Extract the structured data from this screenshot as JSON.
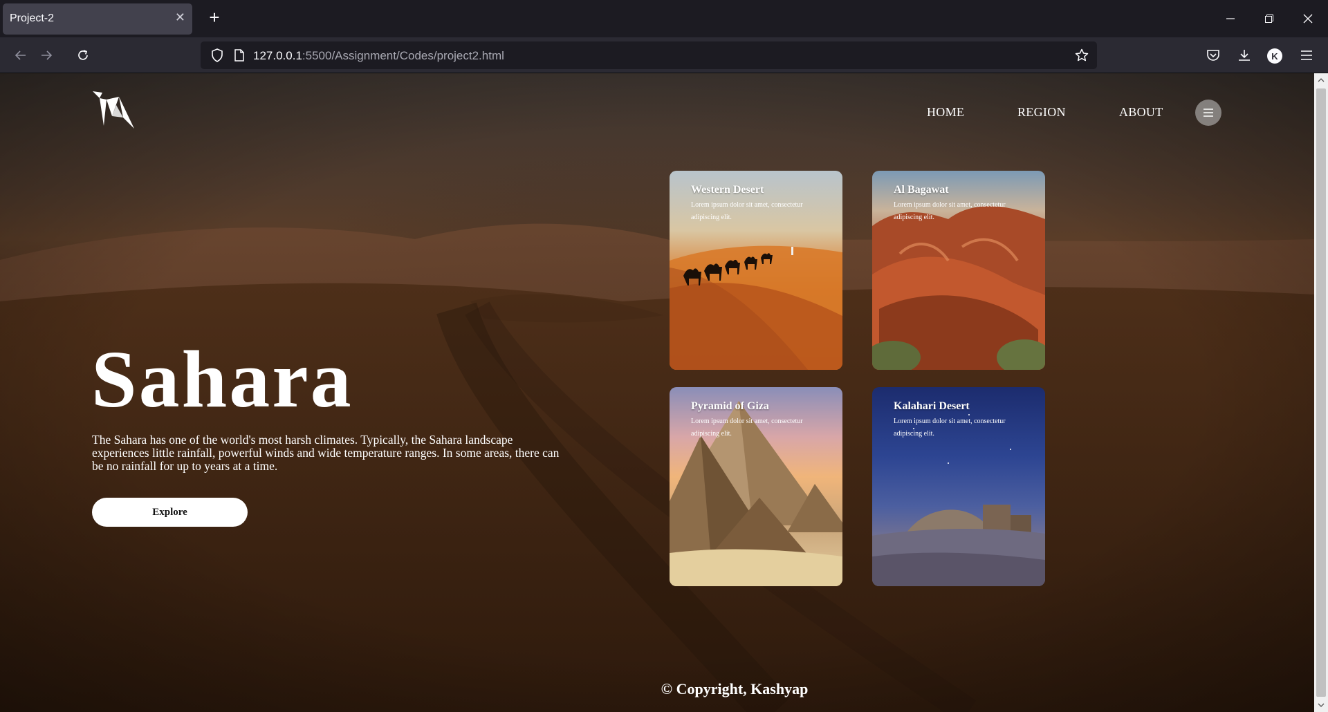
{
  "browser": {
    "tab_title": "Project-2",
    "close_glyph": "✕",
    "new_tab_glyph": "+",
    "url_host": "127.0.0.1",
    "url_rest": ":5500/Assignment/Codes/project2.html",
    "avatar_letter": "K",
    "accent": "#42414d"
  },
  "site": {
    "nav": {
      "home": "HOME",
      "region": "REGION",
      "about": "ABOUT"
    },
    "hero": {
      "title": "Sahara",
      "description": "The Sahara has one of the world's most harsh climates. Typically, the Sahara landscape experiences little rainfall, powerful winds and wide temperature ranges. In some areas, there can be no rainfall for up to years at a time.",
      "button": "Explore"
    },
    "cards": [
      {
        "title": "Western Desert",
        "text": "Lorem ipsum dolor sit amet, consectetur adipiscing elit."
      },
      {
        "title": "Al Bagawat",
        "text": "Lorem ipsum dolor sit amet, consectetur adipiscing elit."
      },
      {
        "title": "Pyramid of Giza",
        "text": "Lorem ipsum dolor sit amet, consectetur adipiscing elit."
      },
      {
        "title": "Kalahari Desert",
        "text": "Lorem ipsum dolor sit amet, consectetur adipiscing elit."
      }
    ],
    "footer": "© Copyright, Kashyap"
  }
}
